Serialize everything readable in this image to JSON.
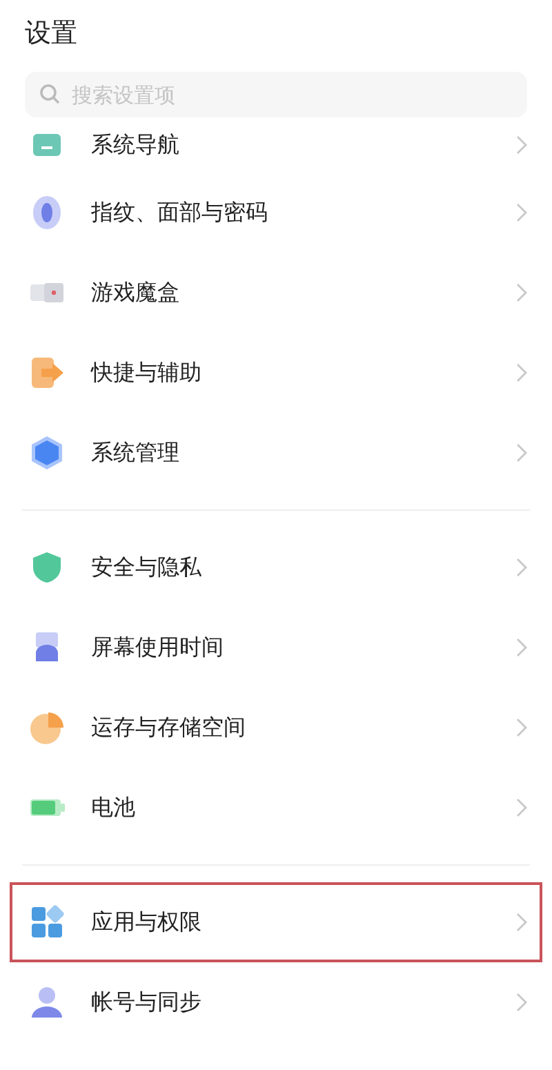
{
  "title": "设置",
  "search": {
    "placeholder": "搜索设置项"
  },
  "sections": [
    {
      "items": [
        {
          "label": "系统导航",
          "kind": "nav",
          "highlighted": false
        },
        {
          "label": "指纹、面部与密码",
          "kind": "fingerprint",
          "highlighted": false
        },
        {
          "label": "游戏魔盒",
          "kind": "game",
          "highlighted": false
        },
        {
          "label": "快捷与辅助",
          "kind": "shortcut",
          "highlighted": false
        },
        {
          "label": "系统管理",
          "kind": "system",
          "highlighted": false
        }
      ]
    },
    {
      "items": [
        {
          "label": "安全与隐私",
          "kind": "security",
          "highlighted": false
        },
        {
          "label": "屏幕使用时间",
          "kind": "screentime",
          "highlighted": false
        },
        {
          "label": "运存与存储空间",
          "kind": "storage",
          "highlighted": false
        },
        {
          "label": "电池",
          "kind": "battery",
          "highlighted": false
        }
      ]
    },
    {
      "items": [
        {
          "label": "应用与权限",
          "kind": "apps",
          "highlighted": true
        },
        {
          "label": "帐号与同步",
          "kind": "account",
          "highlighted": false
        }
      ]
    }
  ]
}
